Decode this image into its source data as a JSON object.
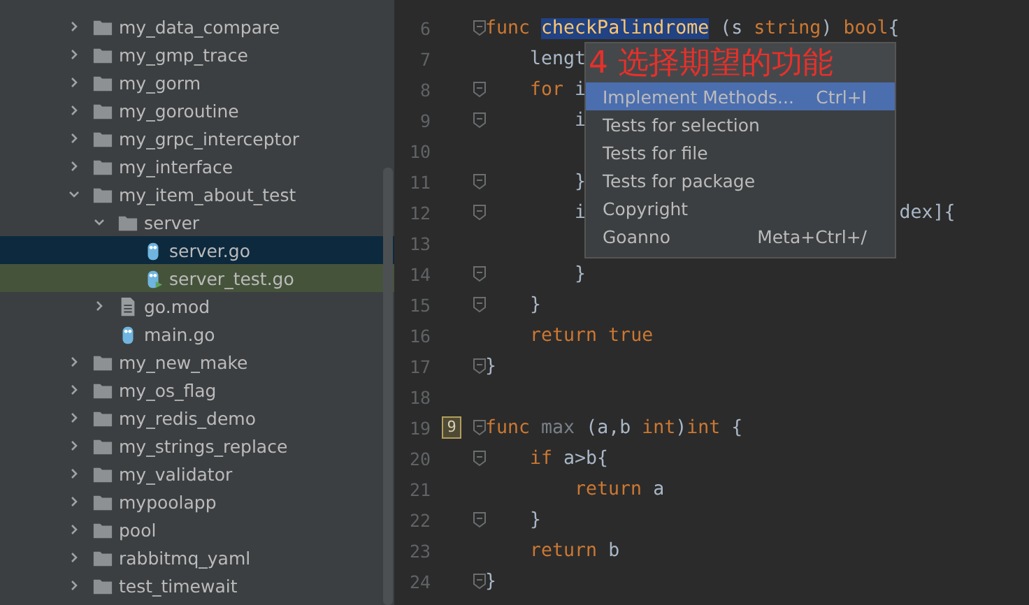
{
  "project_tree": [
    {
      "label": "my_data_compare",
      "kind": "folder",
      "expanded": false,
      "selected": false,
      "highlighted": false
    },
    {
      "label": "my_gmp_trace",
      "kind": "folder",
      "expanded": false,
      "selected": false,
      "highlighted": false
    },
    {
      "label": "my_gorm",
      "kind": "folder",
      "expanded": false,
      "selected": false,
      "highlighted": false
    },
    {
      "label": "my_goroutine",
      "kind": "folder",
      "expanded": false,
      "selected": false,
      "highlighted": false
    },
    {
      "label": "my_grpc_interceptor",
      "kind": "folder",
      "expanded": false,
      "selected": false,
      "highlighted": false
    },
    {
      "label": "my_interface",
      "kind": "folder",
      "expanded": false,
      "selected": false,
      "highlighted": false
    },
    {
      "label": "my_item_about_test",
      "kind": "folder",
      "expanded": true,
      "selected": false,
      "highlighted": false,
      "children": [
        {
          "label": "server",
          "kind": "folder",
          "expanded": true,
          "selected": false,
          "highlighted": false,
          "children": [
            {
              "label": "server.go",
              "kind": "go-file",
              "selected": true,
              "highlighted": false
            },
            {
              "label": "server_test.go",
              "kind": "go-test-file",
              "selected": false,
              "highlighted": true
            }
          ]
        },
        {
          "label": "go.mod",
          "kind": "mod-file",
          "expanded": false,
          "selected": false,
          "highlighted": false
        },
        {
          "label": "main.go",
          "kind": "go-file",
          "selected": false,
          "highlighted": false
        }
      ]
    },
    {
      "label": "my_new_make",
      "kind": "folder",
      "expanded": false,
      "selected": false,
      "highlighted": false
    },
    {
      "label": "my_os_flag",
      "kind": "folder",
      "expanded": false,
      "selected": false,
      "highlighted": false
    },
    {
      "label": "my_redis_demo",
      "kind": "folder",
      "expanded": false,
      "selected": false,
      "highlighted": false
    },
    {
      "label": "my_strings_replace",
      "kind": "folder",
      "expanded": false,
      "selected": false,
      "highlighted": false
    },
    {
      "label": "my_validator",
      "kind": "folder",
      "expanded": false,
      "selected": false,
      "highlighted": false
    },
    {
      "label": "mypoolapp",
      "kind": "folder",
      "expanded": false,
      "selected": false,
      "highlighted": false
    },
    {
      "label": "pool",
      "kind": "folder",
      "expanded": false,
      "selected": false,
      "highlighted": false
    },
    {
      "label": "rabbitmq_yaml",
      "kind": "folder",
      "expanded": false,
      "selected": false,
      "highlighted": false
    },
    {
      "label": "test_timewait",
      "kind": "folder",
      "expanded": false,
      "selected": false,
      "highlighted": false
    }
  ],
  "editor": {
    "lines": [
      {
        "number": "6",
        "fold": true,
        "kind": "top",
        "tokens": [
          {
            "text": "func",
            "kind": "keyword"
          },
          {
            "text": "checkPalindrome",
            "kind": "function-selected"
          },
          {
            "text": "(s",
            "kind": "plain"
          },
          {
            "text": "string",
            "kind": "keyword"
          },
          {
            "text": ")",
            "kind": "plain-tight"
          },
          {
            "text": "bool",
            "kind": "keyword"
          },
          {
            "text": "{",
            "kind": "plain-tight"
          }
        ]
      },
      {
        "number": "7",
        "fold": false,
        "kind": "inner",
        "tokens": [
          {
            "text": "lengt",
            "kind": "plain"
          }
        ]
      },
      {
        "number": "8",
        "fold": true,
        "kind": "inner",
        "tokens": [
          {
            "text": "for",
            "kind": "keyword"
          },
          {
            "text": "i",
            "kind": "plain"
          }
        ]
      },
      {
        "number": "9",
        "fold": true,
        "kind": "nested",
        "tokens": [
          {
            "text": "i",
            "kind": "plain"
          }
        ]
      },
      {
        "number": "10",
        "fold": false,
        "kind": "top"
      },
      {
        "number": "11",
        "fold": true,
        "kind": "nested",
        "tokens": [
          {
            "text": "}",
            "kind": "plain"
          }
        ]
      },
      {
        "number": "12",
        "fold": true,
        "kind": "nested",
        "tokens": [
          {
            "text": "i",
            "kind": "plain"
          }
        ],
        "tail": "dex]{"
      },
      {
        "number": "13",
        "fold": false,
        "kind": "top"
      },
      {
        "number": "14",
        "fold": true,
        "kind": "nested",
        "tokens": [
          {
            "text": "}",
            "kind": "plain"
          }
        ]
      },
      {
        "number": "15",
        "fold": true,
        "kind": "inner",
        "tokens": [
          {
            "text": "}",
            "kind": "plain"
          }
        ]
      },
      {
        "number": "16",
        "fold": false,
        "kind": "inner",
        "tokens": [
          {
            "text": "return true",
            "kind": "keyword"
          }
        ]
      },
      {
        "number": "17",
        "fold": true,
        "kind": "top",
        "tokens": [
          {
            "text": "}",
            "kind": "plain"
          }
        ]
      },
      {
        "number": "18",
        "fold": false,
        "kind": "top"
      },
      {
        "number": "19",
        "fold": true,
        "kind": "top",
        "badge": "9",
        "tokens": [
          {
            "text": "func",
            "kind": "keyword"
          },
          {
            "text": "max",
            "kind": "unused"
          },
          {
            "text": "(a,b",
            "kind": "plain"
          },
          {
            "text": "int",
            "kind": "keyword"
          },
          {
            "text": ")",
            "kind": "plain-tight"
          },
          {
            "text": "int",
            "kind": "keyword-tight"
          },
          {
            "text": "{",
            "kind": "plain"
          }
        ]
      },
      {
        "number": "20",
        "fold": true,
        "kind": "inner",
        "tokens": [
          {
            "text": "if",
            "kind": "keyword"
          },
          {
            "text": "a>b{",
            "kind": "plain"
          }
        ]
      },
      {
        "number": "21",
        "fold": false,
        "kind": "nested",
        "tokens": [
          {
            "text": "return",
            "kind": "keyword"
          },
          {
            "text": "a",
            "kind": "plain"
          }
        ]
      },
      {
        "number": "22",
        "fold": true,
        "kind": "inner",
        "tokens": [
          {
            "text": "}",
            "kind": "plain"
          }
        ]
      },
      {
        "number": "23",
        "fold": false,
        "kind": "inner",
        "tokens": [
          {
            "text": "return",
            "kind": "keyword"
          },
          {
            "text": "b",
            "kind": "plain"
          }
        ]
      },
      {
        "number": "24",
        "fold": true,
        "kind": "top",
        "tokens": [
          {
            "text": "}",
            "kind": "plain"
          }
        ]
      }
    ]
  },
  "generate_popup": {
    "items": [
      {
        "label": "Implement Methods...",
        "shortcut": "Ctrl+I",
        "selected": true
      },
      {
        "label": "Tests for selection",
        "selected": false
      },
      {
        "label": "Tests for file",
        "selected": false
      },
      {
        "label": "Tests for package",
        "selected": false
      },
      {
        "label": "Copyright",
        "selected": false
      },
      {
        "label": "Goanno",
        "shortcut": "Meta+Ctrl+/",
        "selected": false
      }
    ]
  },
  "annotation": "4 选择期望的功能"
}
